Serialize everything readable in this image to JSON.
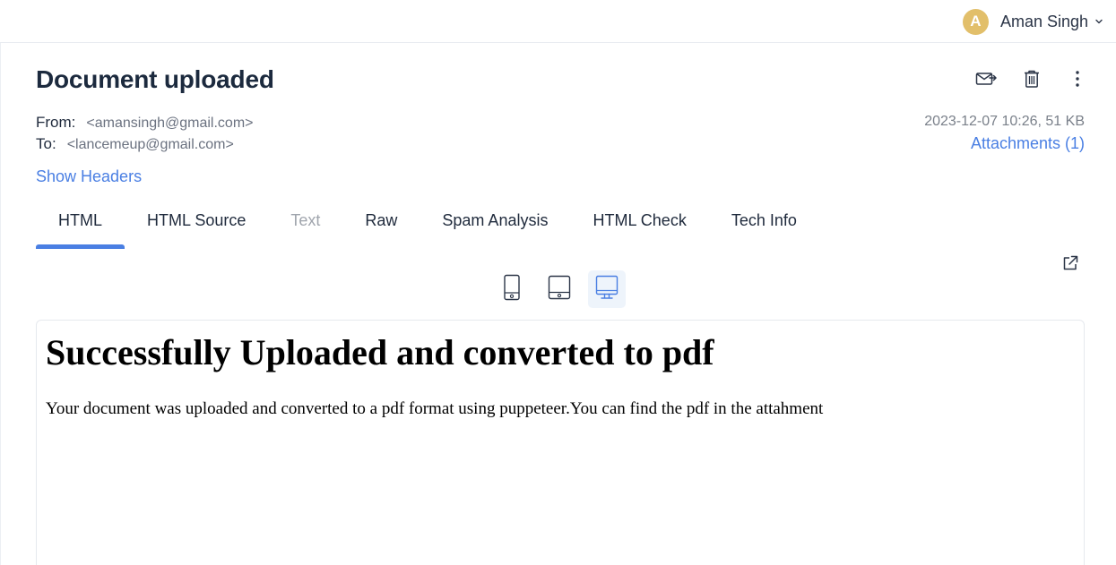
{
  "colors": {
    "accent": "#4a7fe3",
    "avatar": "#e2bf6a",
    "icon": "#2b3547"
  },
  "user": {
    "initial": "A",
    "name": "Aman Singh",
    "icon": "chevron-down-icon"
  },
  "message": {
    "subject": "Document uploaded",
    "from_label": "From:",
    "from": "<amansingh@gmail.com>",
    "to_label": "To:",
    "to": "<lancemeup@gmail.com>",
    "info": "2023-12-07 10:26, 51 KB",
    "attachments": "Attachments (1)",
    "show_headers": "Show Headers"
  },
  "actions": [
    {
      "icon": "forward-mail-icon"
    },
    {
      "icon": "trash-icon"
    },
    {
      "icon": "more-vertical-icon"
    }
  ],
  "tabs": [
    {
      "label": "HTML",
      "state": "active"
    },
    {
      "label": "HTML Source",
      "state": "normal"
    },
    {
      "label": "Text",
      "state": "disabled"
    },
    {
      "label": "Raw",
      "state": "normal"
    },
    {
      "label": "Spam Analysis",
      "state": "normal"
    },
    {
      "label": "HTML Check",
      "state": "normal"
    },
    {
      "label": "Tech Info",
      "state": "normal"
    }
  ],
  "devices": [
    {
      "icon": "mobile-icon",
      "active": false
    },
    {
      "icon": "tablet-icon",
      "active": false
    },
    {
      "icon": "desktop-icon",
      "active": true
    }
  ],
  "preview": {
    "heading": "Successfully Uploaded and converted to pdf",
    "body": "Your document was uploaded and converted to a pdf format using puppeteer.You can find the pdf in the attahment"
  },
  "open_external": {
    "icon": "external-link-icon"
  }
}
